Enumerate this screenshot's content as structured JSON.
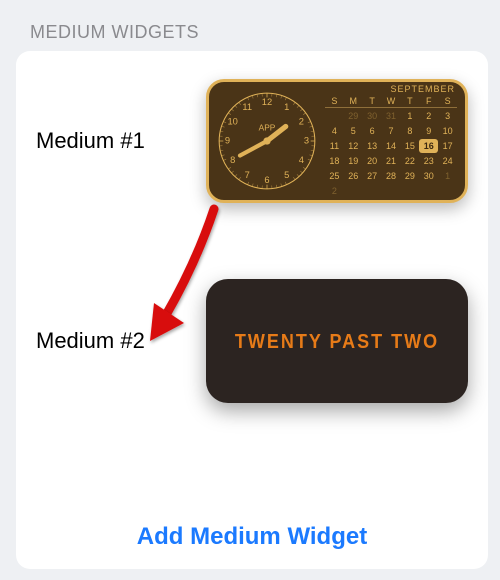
{
  "section_header": "MEDIUM WIDGETS",
  "rows": [
    {
      "label": "Medium #1"
    },
    {
      "label": "Medium #2"
    }
  ],
  "add_button_label": "Add Medium Widget",
  "widget1": {
    "clock_label": "APP",
    "month": "SEPTEMBER",
    "dow": [
      "S",
      "M",
      "T",
      "W",
      "T",
      "F",
      "S"
    ],
    "leading_dim": [
      29,
      30,
      31
    ],
    "days": [
      1,
      2,
      3,
      4,
      5,
      6,
      7,
      8,
      9,
      10,
      11,
      12,
      13,
      14,
      15,
      16,
      17,
      18,
      19,
      20,
      21,
      22,
      23,
      24,
      25,
      26,
      27,
      28,
      29,
      30
    ],
    "trailing_dim": [
      1,
      2
    ],
    "today": 16
  },
  "widget2": {
    "text": "TWENTY PAST TWO"
  },
  "colors": {
    "accent_link": "#1b7aff",
    "widget1_bg": "#4a3417",
    "widget1_fg": "#e0b258",
    "widget2_bg": "#2c2421",
    "widget2_fg": "#e77b18",
    "arrow": "#d80c0c"
  }
}
